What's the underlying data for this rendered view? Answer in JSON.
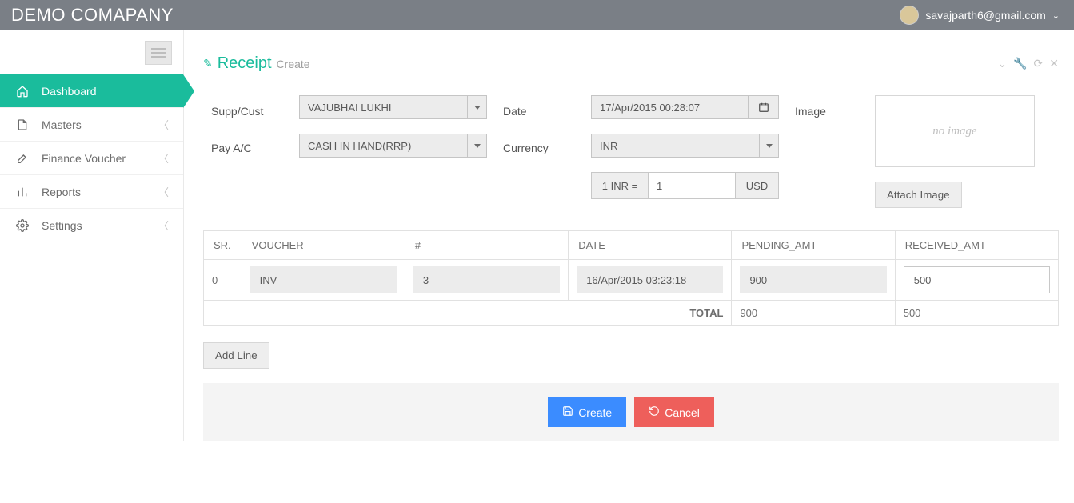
{
  "header": {
    "company": "DEMO COMAPANY",
    "user_email": "savajparth6@gmail.com"
  },
  "sidebar": {
    "items": [
      {
        "label": "Dashboard"
      },
      {
        "label": "Masters"
      },
      {
        "label": "Finance Voucher"
      },
      {
        "label": "Reports"
      },
      {
        "label": "Settings"
      }
    ]
  },
  "panel": {
    "title": "Receipt",
    "subtitle": "Create"
  },
  "form": {
    "supp_cust_label": "Supp/Cust",
    "supp_cust_value": "VAJUBHAI LUKHI",
    "pay_ac_label": "Pay A/C",
    "pay_ac_value": "CASH IN HAND(RRP)",
    "date_label": "Date",
    "date_value": "17/Apr/2015 00:28:07",
    "currency_label": "Currency",
    "currency_value": "INR",
    "rate_prefix": "1 INR =",
    "rate_value": "1",
    "rate_suffix": "USD",
    "image_label": "Image",
    "no_image_text": "no image",
    "attach_image_label": "Attach Image"
  },
  "table": {
    "headers": {
      "sr": "SR.",
      "voucher": "VOUCHER",
      "hash": "#",
      "date": "DATE",
      "pending": "PENDING_AMT",
      "received": "RECEIVED_AMT"
    },
    "rows": [
      {
        "sr": "0",
        "voucher": "INV",
        "hash": "3",
        "date": "16/Apr/2015 03:23:18",
        "pending": "900",
        "received": "500"
      }
    ],
    "total_label": "TOTAL",
    "total_pending": "900",
    "total_received": "500"
  },
  "buttons": {
    "add_line": "Add Line",
    "create": "Create",
    "cancel": "Cancel"
  }
}
